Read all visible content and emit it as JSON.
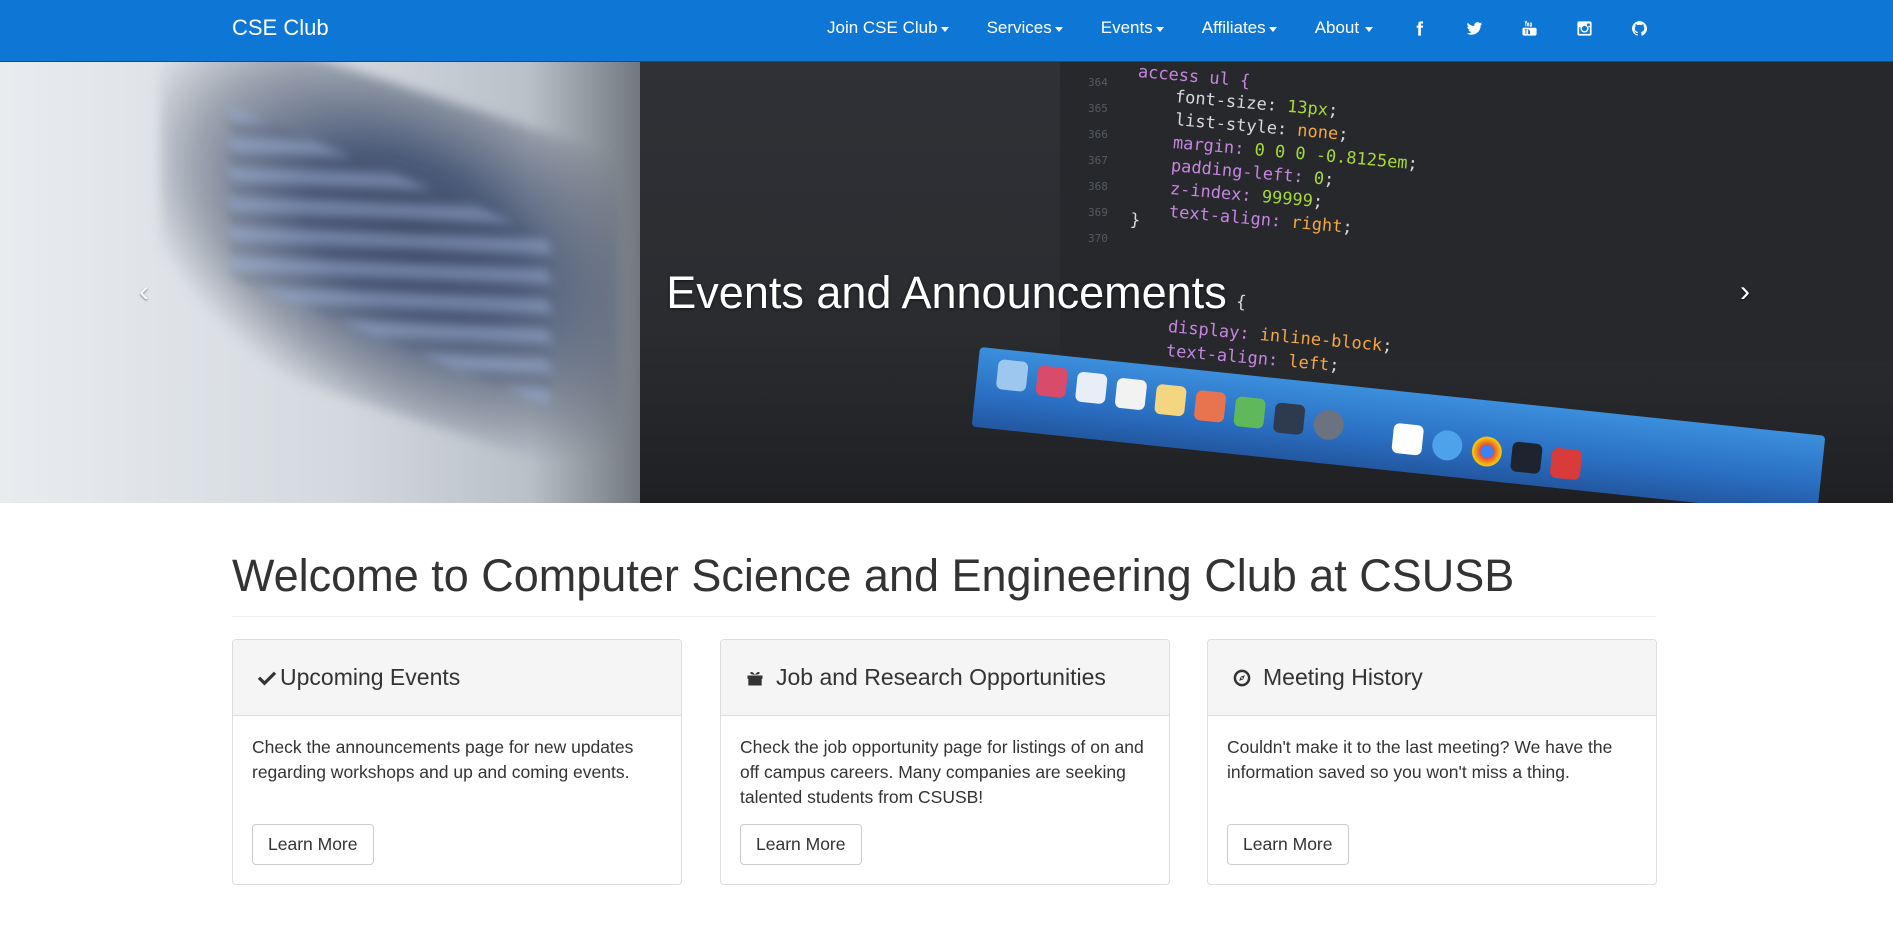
{
  "navbar": {
    "brand": "CSE Club",
    "menu": [
      {
        "label": "Join CSE Club"
      },
      {
        "label": "Services"
      },
      {
        "label": "Events"
      },
      {
        "label": "Affiliates"
      },
      {
        "label": "About"
      }
    ],
    "social": [
      "facebook-icon",
      "twitter-icon",
      "youtube-icon",
      "instagram-icon",
      "github-icon"
    ],
    "color": "#0e76d4"
  },
  "hero": {
    "caption": "Events and Announcements",
    "prev": "‹",
    "next": "›",
    "slides": 2,
    "active_slide": 1,
    "code": {
      "l1": "access ul {",
      "l2p": "font-size: ",
      "l2v": "13px",
      "l2e": ";",
      "l3p": "list-style: ",
      "l3v": "none",
      "l3e": ";",
      "l4p": "margin: ",
      "l4v": "0 0 0 -0.8125em",
      "l4e": ";",
      "l5p": "padding-left: ",
      "l5v": "0",
      "l5e": ";",
      "l6p": "z-index: ",
      "l6v": "99999",
      "l6e": ";",
      "l7p": "text-align: ",
      "l7v": "right",
      "l7e": ";",
      "l8": "}",
      "l9": "{",
      "l10p": "display: ",
      "l10v": "inline-block",
      "l10e": ";",
      "l11p": "text-align: ",
      "l11v": "left",
      "l11e": ";"
    }
  },
  "main": {
    "title": "Welcome to Computer Science and Engineering Club at CSUSB",
    "panels": [
      {
        "icon": "check-icon",
        "heading": "Upcoming Events",
        "body": "Check the announcements page for new updates regarding workshops and up and coming events.",
        "button": "Learn More"
      },
      {
        "icon": "gift-icon",
        "heading": "Job and Research Opportunities",
        "body": "Check the job opportunity page for listings of on and off campus careers. Many companies are seeking talented students from CSUSB!",
        "button": "Learn More"
      },
      {
        "icon": "compass-icon",
        "heading": "Meeting History",
        "body": "Couldn't make it to the last meeting? We have the information saved so you won't miss a thing.",
        "button": "Learn More"
      }
    ]
  }
}
